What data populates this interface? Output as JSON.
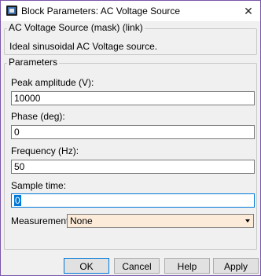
{
  "window": {
    "title": "Block Parameters: AC Voltage Source",
    "icon": "simulink-block-icon"
  },
  "block_group": {
    "title": "AC Voltage Source (mask) (link)",
    "description": "Ideal sinusoidal AC Voltage source."
  },
  "parameters": {
    "title": "Parameters",
    "fields": [
      {
        "label": "Peak amplitude (V):",
        "value": "10000"
      },
      {
        "label": "Phase (deg):",
        "value": "0"
      },
      {
        "label": "Frequency (Hz):",
        "value": "50"
      },
      {
        "label": "Sample time:",
        "value": "0"
      }
    ],
    "measurements_label": "Measurements",
    "measurements_value": "None"
  },
  "buttons": {
    "ok": "OK",
    "cancel": "Cancel",
    "help": "Help",
    "apply": "Apply"
  },
  "colors": {
    "window_border": "#7a55a8",
    "dropdown_bg": "#fcebd8",
    "accent": "#0078d7"
  }
}
